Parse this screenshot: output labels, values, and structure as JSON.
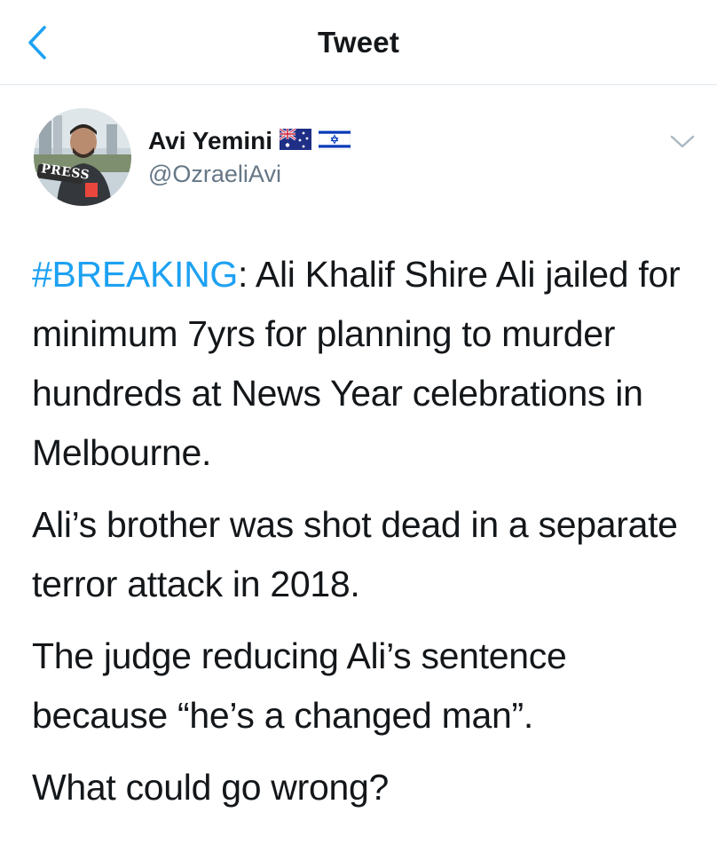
{
  "nav": {
    "title": "Tweet",
    "back_icon": "chevron-left-icon"
  },
  "author": {
    "name": "Avi Yemini",
    "handle": "@OzraeliAvi",
    "flags": [
      "australia-flag-icon",
      "israel-flag-icon"
    ],
    "avatar_text": "PRESS"
  },
  "tweet": {
    "hashtag": "#BREAKING",
    "p1_rest": ": Ali Khalif Shire Ali jailed for minimum 7yrs for planning to murder hundreds at News Year celebrations in Melbourne.",
    "p2": "Ali’s brother was shot dead in a separate terror attack in 2018.",
    "p3": "The judge reducing Ali’s sentence because “he’s a changed man”.",
    "p4": "What could go wrong?"
  },
  "colors": {
    "accent": "#1da1f2",
    "text": "#14171a",
    "secondary": "#657786",
    "divider": "#e1e8ed"
  }
}
